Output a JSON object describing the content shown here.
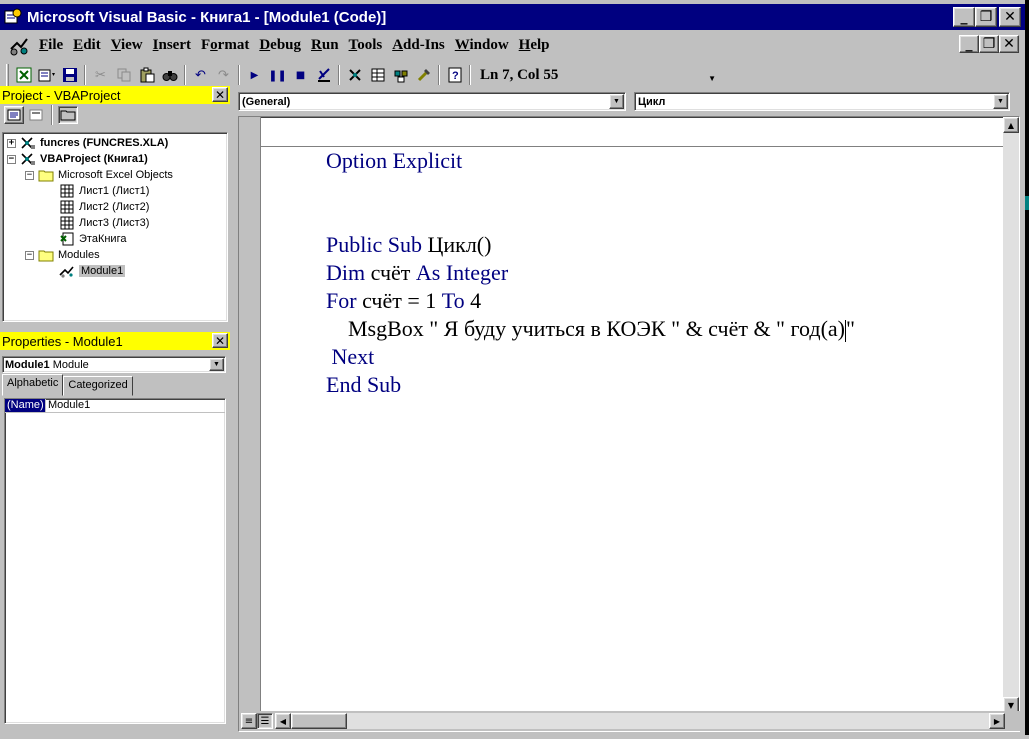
{
  "window": {
    "title": "Microsoft Visual Basic - Книга1 - [Module1 (Code)]",
    "minimize": "_",
    "restore": "❐",
    "close": "✕"
  },
  "menu": {
    "items": [
      {
        "label": "File",
        "accel": "F",
        "rest": "ile"
      },
      {
        "label": "Edit",
        "accel": "E",
        "rest": "dit"
      },
      {
        "label": "View",
        "accel": "V",
        "rest": "iew"
      },
      {
        "label": "Insert",
        "accel": "I",
        "rest": "nsert"
      },
      {
        "label": "Format",
        "accel": "o",
        "pre": "F",
        "rest": "rmat"
      },
      {
        "label": "Debug",
        "accel": "D",
        "rest": "ebug"
      },
      {
        "label": "Run",
        "accel": "R",
        "rest": "un"
      },
      {
        "label": "Tools",
        "accel": "T",
        "rest": "ools"
      },
      {
        "label": "Add-Ins",
        "accel": "A",
        "rest": "dd-Ins"
      },
      {
        "label": "Window",
        "accel": "W",
        "rest": "indow"
      },
      {
        "label": "Help",
        "accel": "H",
        "rest": "elp"
      }
    ]
  },
  "toolbar": {
    "position": "Ln 7, Col 55"
  },
  "project": {
    "title": "Project - VBAProject",
    "close": "✕",
    "tree": [
      {
        "label": "funcres (FUNCRES.XLA)",
        "bold": true,
        "exp": "+",
        "icon": "vba-project-icon"
      },
      {
        "label": "VBAProject (Книга1)",
        "bold": true,
        "exp": "−",
        "icon": "vba-project-icon"
      },
      {
        "label": "Microsoft Excel Objects",
        "exp": "−",
        "icon": "folder-icon"
      },
      {
        "label": "Лист1 (Лист1)",
        "icon": "worksheet-icon"
      },
      {
        "label": "Лист2 (Лист2)",
        "icon": "worksheet-icon"
      },
      {
        "label": "Лист3 (Лист3)",
        "icon": "worksheet-icon"
      },
      {
        "label": "ЭтаКнига",
        "icon": "workbook-icon"
      },
      {
        "label": "Modules",
        "exp": "−",
        "icon": "folder-icon"
      },
      {
        "label": "Module1",
        "icon": "module-icon",
        "selected": true
      }
    ]
  },
  "properties": {
    "title": "Properties - Module1",
    "close": "✕",
    "object_name": "Module1",
    "object_type": "Module",
    "tabs": [
      "Alphabetic",
      "Categorized"
    ],
    "rows": [
      {
        "name": "(Name)",
        "value": "Module1"
      }
    ]
  },
  "code": {
    "object_combo": "(General)",
    "procedure_combo": "Цикл",
    "lines": {
      "l1": {
        "kw": "Option Explicit"
      },
      "l2": {
        "kw": "Public Sub",
        "txt": " Цикл()"
      },
      "l3": {
        "kw": "Dim",
        "txt": " счёт ",
        "kw2": "As Integer"
      },
      "l4": {
        "kw": "For",
        "txt": " счёт = 1 ",
        "kw2": "To",
        "txt2": " 4"
      },
      "l5": {
        "txt": "    MsgBox \" Я буду учиться в КОЭК \" & счёт & \" год(а)",
        "txt2": "\""
      },
      "l6": {
        "kw": " Next"
      },
      "l7": {
        "kw": "End Sub"
      }
    }
  },
  "colors": {
    "title_bar": "#000080",
    "panel_title": "#ffff00",
    "keyword": "#000080",
    "face": "#c0c0c0"
  }
}
